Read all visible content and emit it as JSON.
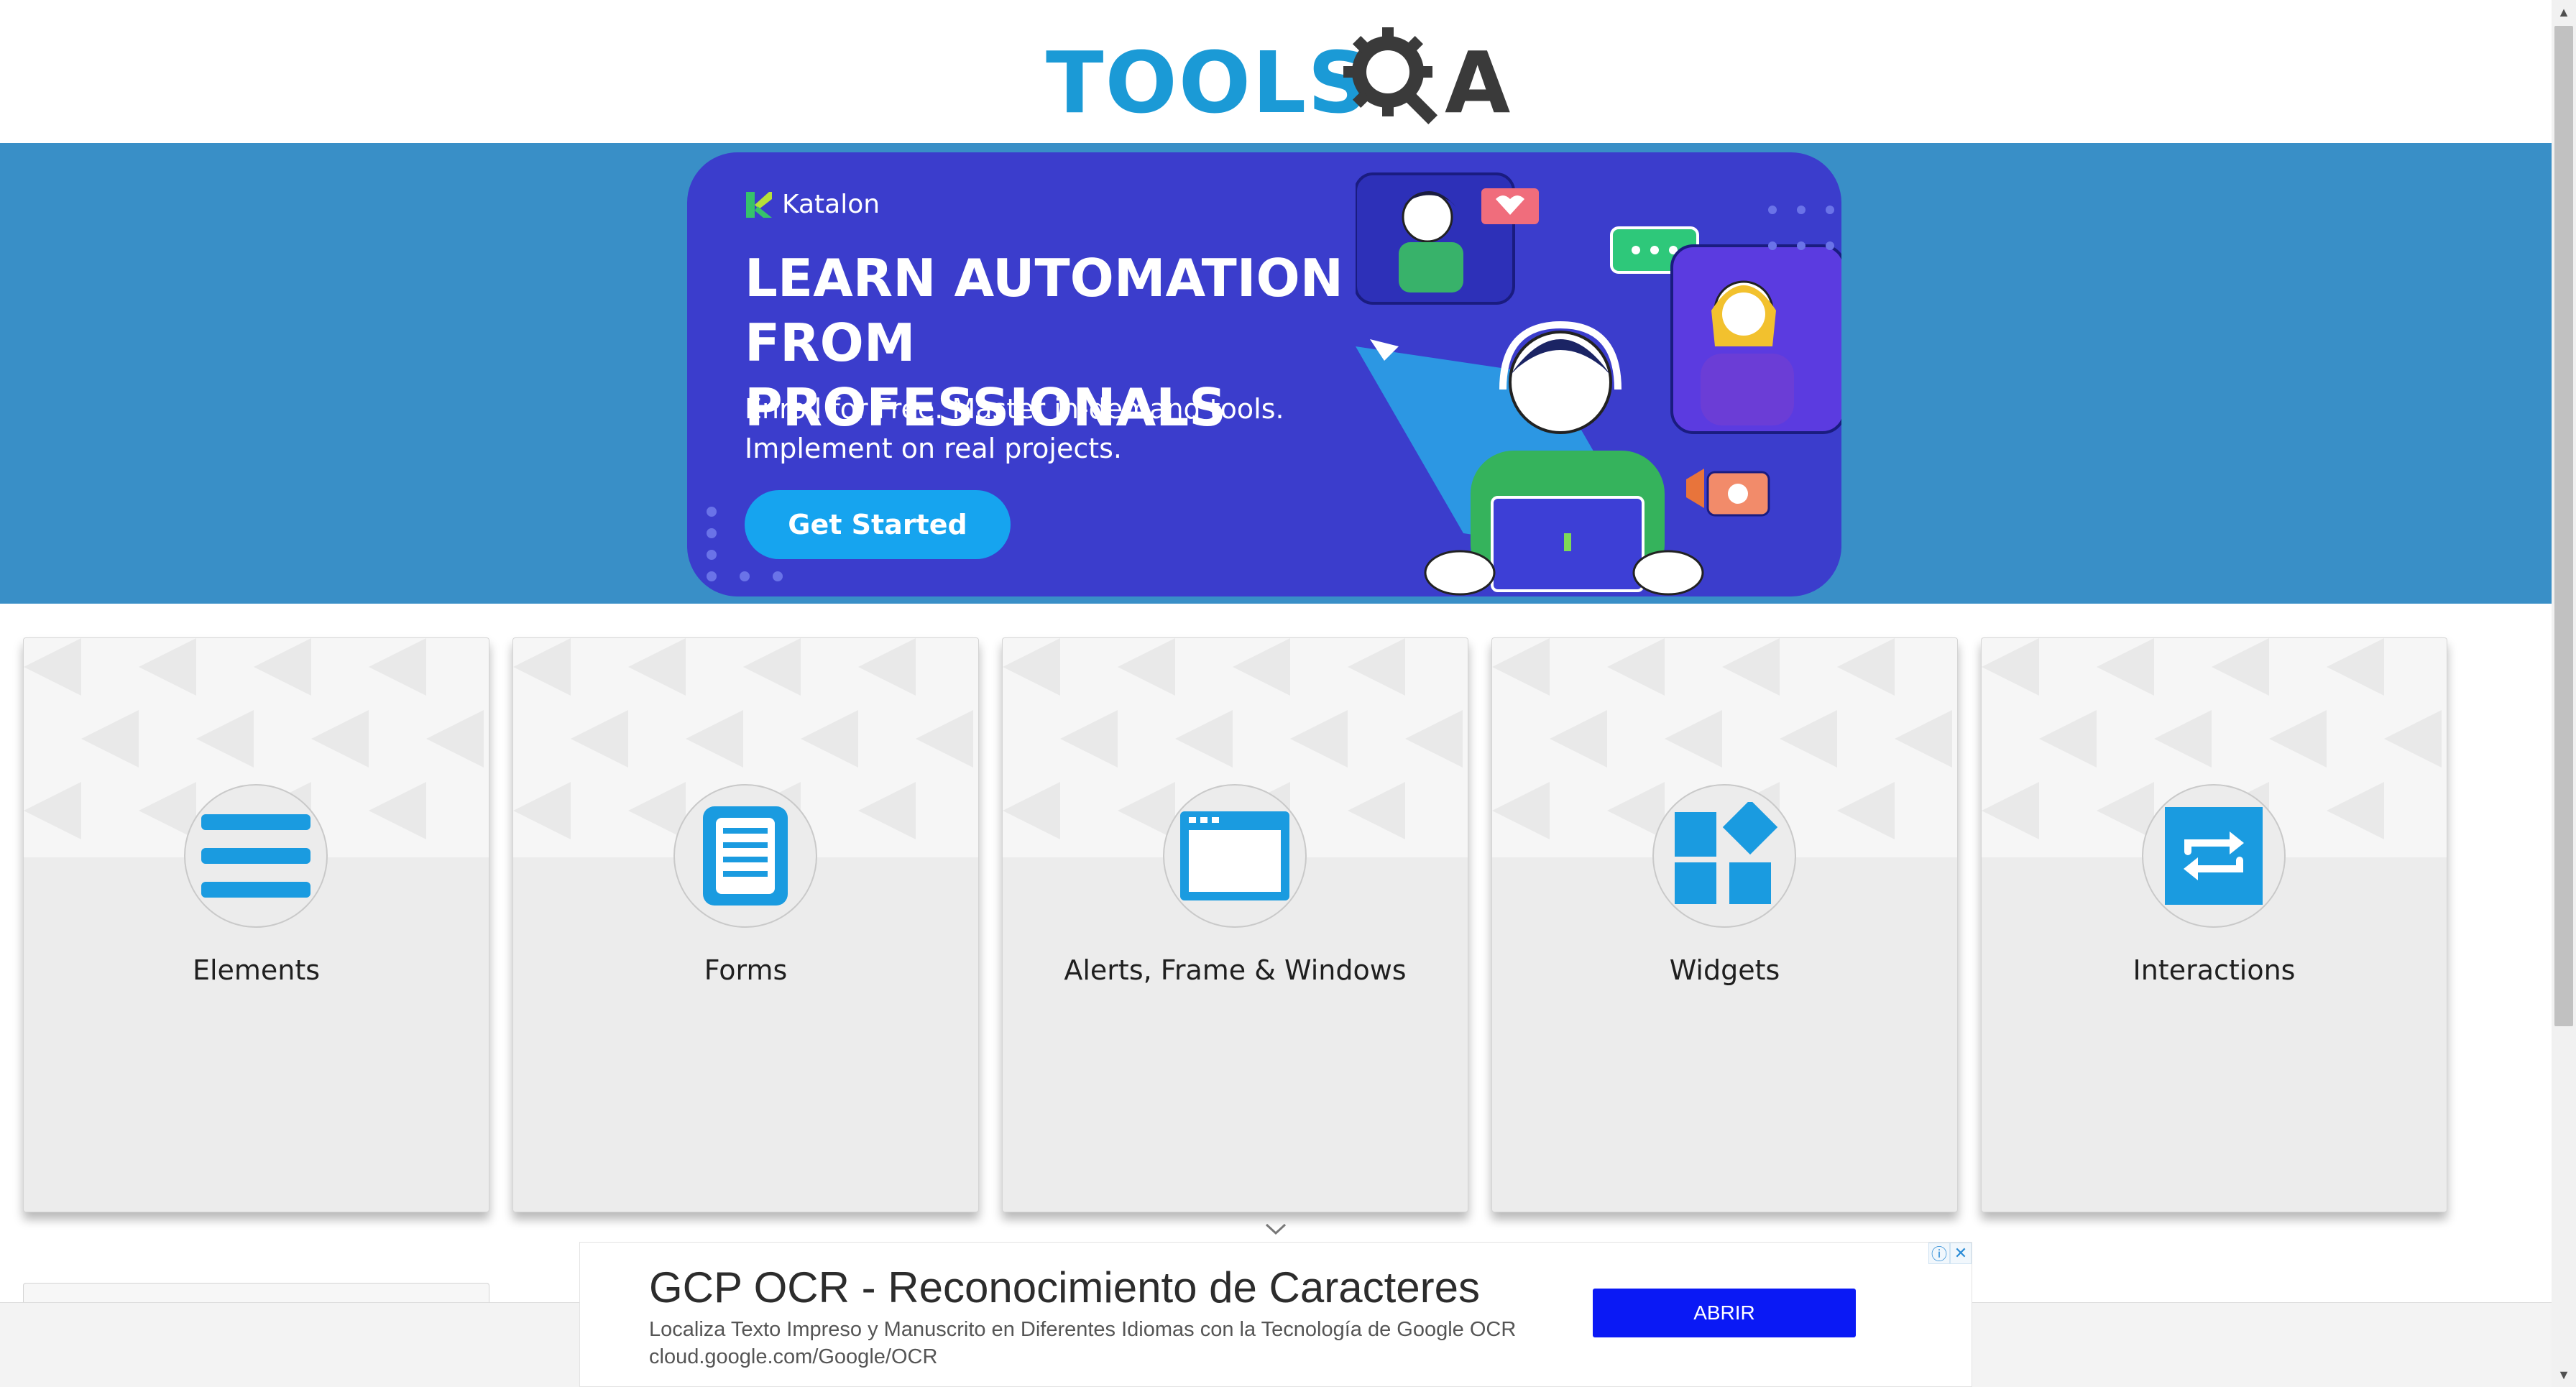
{
  "header": {
    "logo_text_tools": "TOOLS",
    "logo_text_a": "A",
    "logo_alt": "ToolsQA"
  },
  "banner": {
    "brand": "Katalon",
    "title_line1": "LEARN AUTOMATION",
    "title_line2": "FROM PROFESSIONALS",
    "subtitle_line1": "Enroll for Free. Master in-demand tools.",
    "subtitle_line2": "Implement on real projects.",
    "cta_label": "Get Started",
    "band_color": "#398fc7",
    "card_color": "#3b3dcc",
    "cta_color": "#16a4ef"
  },
  "cards": [
    {
      "title": "Elements",
      "icon": "hamburger-lines-icon"
    },
    {
      "title": "Forms",
      "icon": "document-form-icon"
    },
    {
      "title": "Alerts, Frame & Windows",
      "icon": "browser-window-icon"
    },
    {
      "title": "Widgets",
      "icon": "widgets-grid-icon"
    },
    {
      "title": "Interactions",
      "icon": "swap-arrows-icon"
    }
  ],
  "ad": {
    "title": "GCP OCR - Reconocimiento de Caracteres",
    "description": "Localiza Texto Impreso y Manuscrito en Diferentes Idiomas con la Tecnología de Google OCR cloud.google.com/Google/OCR",
    "button_label": "ABRIR",
    "button_color": "#0a19f5"
  },
  "colors": {
    "accent": "#1b9ad6",
    "icon_blue": "#1a9be0",
    "card_bg": "#ececec"
  }
}
